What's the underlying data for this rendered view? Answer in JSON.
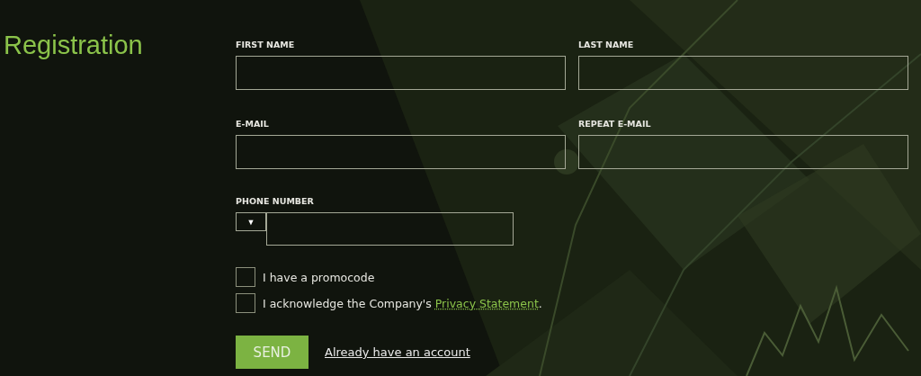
{
  "title": "Registration",
  "fields": [
    {
      "label": "FIRST NAME"
    },
    {
      "label": "LAST NAME"
    },
    {
      "label": "E-MAIL"
    },
    {
      "label": "REPEAT E-MAIL"
    }
  ],
  "phone": {
    "label": "PHONE NUMBER",
    "dropdown_icon": "▼"
  },
  "checkboxes": [
    {
      "kind": "plain",
      "text": "I have a promocode",
      "checked": false
    },
    {
      "kind": "link",
      "text": "I acknowledge the Company's ",
      "link": "Privacy Statement",
      "after": ".",
      "checked": false
    }
  ],
  "send_button": "SEND",
  "account_link": "Already have an account"
}
